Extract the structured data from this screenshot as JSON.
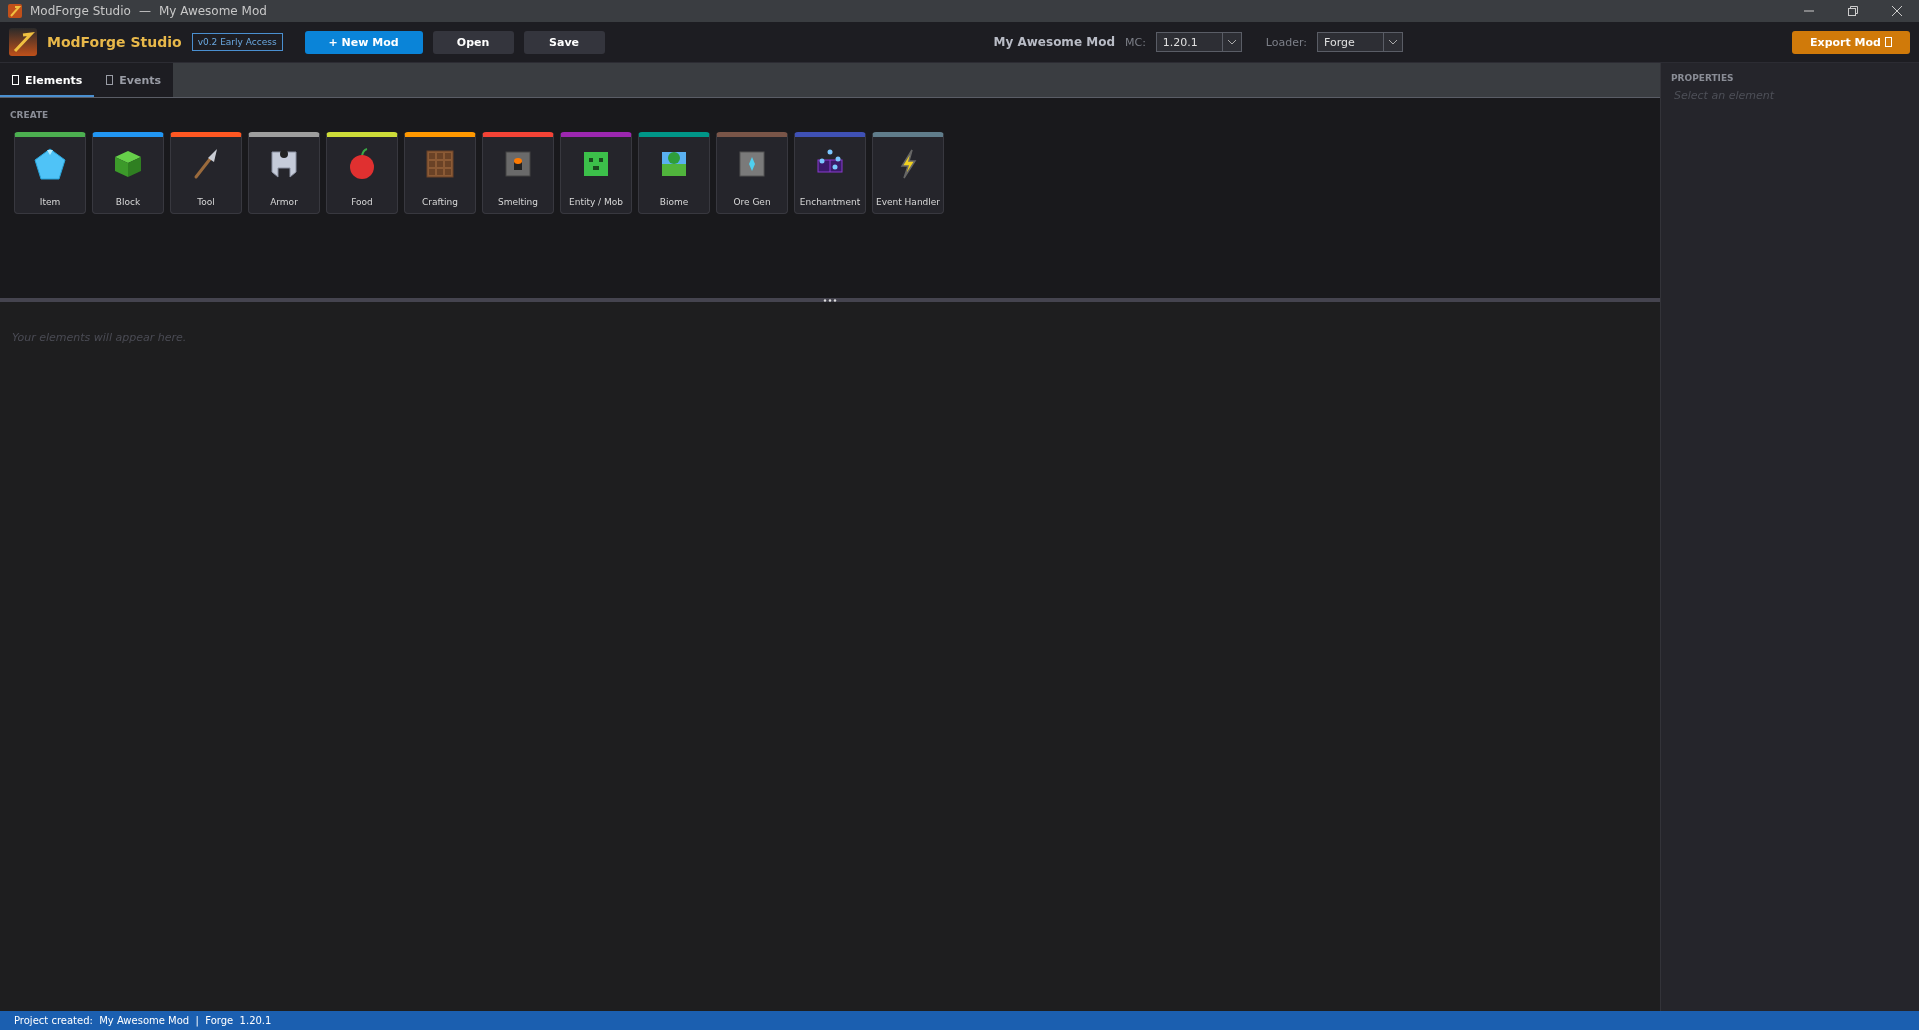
{
  "window": {
    "title_app": "ModForge Studio",
    "title_sep": "—",
    "title_doc": "My Awesome Mod"
  },
  "toolbar": {
    "app_name": "ModForge Studio",
    "version_badge": "v0.2 Early Access",
    "buttons": [
      {
        "label": "+ New Mod",
        "kind": "primary"
      },
      {
        "label": "Open",
        "kind": "plain"
      },
      {
        "label": "Save",
        "kind": "plain"
      }
    ],
    "mod_name": "My Awesome Mod",
    "mc_label": "MC:",
    "mc_value": "1.20.1",
    "loader_label": "Loader:",
    "loader_value": "Forge",
    "export_label": "Export Mod"
  },
  "tabs": [
    {
      "label": "Elements",
      "selected": true
    },
    {
      "label": "Events",
      "selected": false
    }
  ],
  "create": {
    "heading": "CREATE",
    "tiles": [
      {
        "label": "Item",
        "color": "#4caf50",
        "kind": "item"
      },
      {
        "label": "Block",
        "color": "#2196f3",
        "kind": "block"
      },
      {
        "label": "Tool",
        "color": "#ff5722",
        "kind": "tool"
      },
      {
        "label": "Armor",
        "color": "#9e9e9e",
        "kind": "armor"
      },
      {
        "label": "Food",
        "color": "#cddc39",
        "kind": "food"
      },
      {
        "label": "Crafting",
        "color": "#ff9800",
        "kind": "crafting"
      },
      {
        "label": "Smelting",
        "color": "#f44336",
        "kind": "smelting"
      },
      {
        "label": "Entity / Mob",
        "color": "#9c27b0",
        "kind": "mob"
      },
      {
        "label": "Biome",
        "color": "#009688",
        "kind": "biome"
      },
      {
        "label": "Ore Gen",
        "color": "#795548",
        "kind": "ore"
      },
      {
        "label": "Enchantment",
        "color": "#3f51b5",
        "kind": "enchant"
      },
      {
        "label": "Event Handler",
        "color": "#607d8b",
        "kind": "event"
      }
    ]
  },
  "elements": {
    "empty_text": "Your elements will appear here."
  },
  "properties": {
    "heading": "PROPERTIES",
    "empty_hint": "Select an element"
  },
  "status_bar": {
    "text": "Project created:  My Awesome Mod  |  Forge  1.20.1"
  }
}
